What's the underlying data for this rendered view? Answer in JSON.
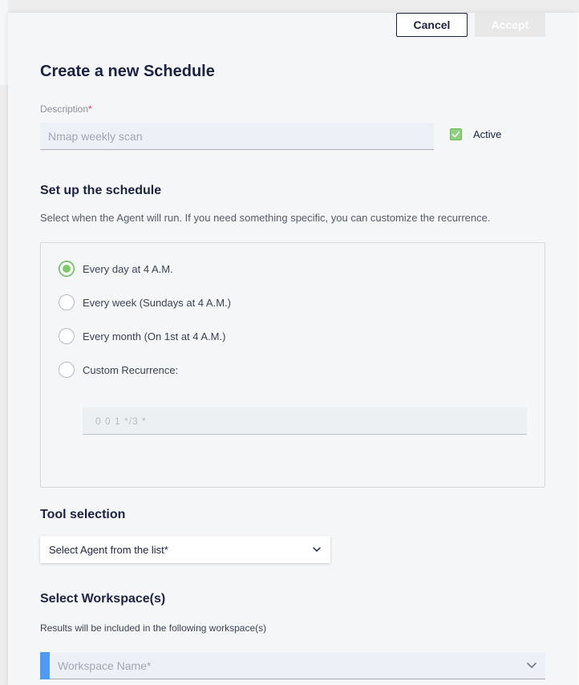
{
  "buttons": {
    "cancel": "Cancel",
    "accept": "Accept"
  },
  "title": "Create a new Schedule",
  "description": {
    "label": "Description",
    "required_mark": "*",
    "placeholder": "Nmap weekly scan",
    "value": ""
  },
  "active": {
    "label": "Active",
    "checked": true
  },
  "schedule": {
    "heading": "Set up the schedule",
    "help": "Select when the Agent will run. If you need something specific, you can customize the recurrence.",
    "options": [
      {
        "label": "Every day at 4 A.M.",
        "selected": true
      },
      {
        "label": "Every week (Sundays at 4 A.M.)",
        "selected": false
      },
      {
        "label": "Every month (On 1st at 4 A.M.)",
        "selected": false
      },
      {
        "label": "Custom Recurrence:",
        "selected": false
      }
    ],
    "custom_placeholder": "0 0 1 */3 *"
  },
  "tool": {
    "heading": "Tool selection",
    "select_text": "Select Agent from the list*"
  },
  "workspace": {
    "heading": "Select Workspace(s)",
    "help": "Results will be included in the following workspace(s)",
    "placeholder": "Workspace Name*"
  },
  "colors": {
    "accent_green": "#7cc86a",
    "accent_blue": "#4f9bf2",
    "required_red": "#ea3158",
    "text_dark": "#1c2243"
  }
}
